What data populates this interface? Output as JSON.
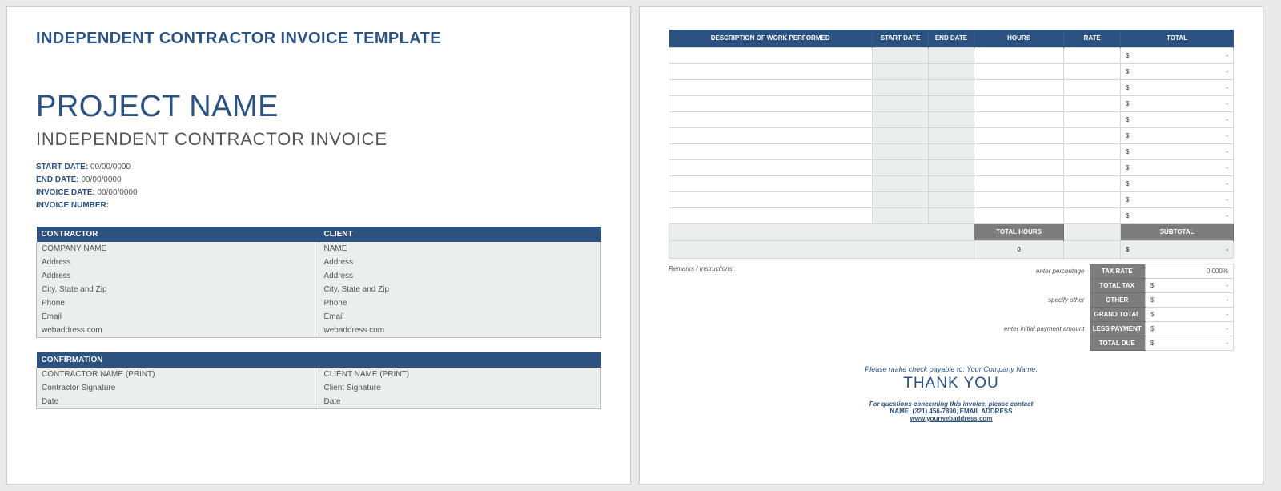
{
  "page1": {
    "title": "INDEPENDENT CONTRACTOR INVOICE TEMPLATE",
    "project": "PROJECT NAME",
    "subtitle": "INDEPENDENT CONTRACTOR INVOICE",
    "meta": {
      "start_label": "START DATE:",
      "start_val": "00/00/0000",
      "end_label": "END DATE:",
      "end_val": "00/00/0000",
      "inv_date_label": "INVOICE DATE:",
      "inv_date_val": "00/00/0000",
      "inv_num_label": "INVOICE NUMBER:",
      "inv_num_val": ""
    },
    "parties": {
      "hdr_contractor": "CONTRACTOR",
      "hdr_client": "CLIENT",
      "rows": [
        [
          "COMPANY NAME",
          "NAME"
        ],
        [
          "Address",
          "Address"
        ],
        [
          "Address",
          "Address"
        ],
        [
          "City, State and Zip",
          "City, State and Zip"
        ],
        [
          "Phone",
          "Phone"
        ],
        [
          "Email",
          "Email"
        ],
        [
          "webaddress.com",
          "webaddress.com"
        ]
      ]
    },
    "confirm": {
      "hdr": "CONFIRMATION",
      "rows": [
        [
          "CONTRACTOR NAME (PRINT)",
          "CLIENT NAME (PRINT)"
        ],
        [
          "Contractor Signature",
          "Client Signature"
        ],
        [
          "Date",
          "Date"
        ]
      ]
    }
  },
  "page2": {
    "headers": {
      "desc": "DESCRIPTION OF WORK PERFORMED",
      "start": "START DATE",
      "end": "END DATE",
      "hours": "HOURS",
      "rate": "RATE",
      "total": "TOTAL"
    },
    "row_total": {
      "cur": "$",
      "dash": "-"
    },
    "row_count": 11,
    "sumrow": {
      "total_hours_label": "TOTAL HOURS",
      "subtotal_label": "SUBTOTAL",
      "total_hours_val": "0",
      "subtotal_cur": "$",
      "subtotal_dash": "-"
    },
    "remarks_label": "Remarks / Instructions:",
    "totals": {
      "tax_hint": "enter percentage",
      "tax_label": "TAX RATE",
      "tax_val": "0.000%",
      "totaltax_label": "TOTAL TAX",
      "other_hint": "specify other",
      "other_label": "OTHER",
      "grand_label": "GRAND TOTAL",
      "less_hint": "enter initial payment amount",
      "less_label": "LESS PAYMENT",
      "due_label": "TOTAL DUE",
      "cur": "$",
      "dash": "-"
    },
    "footer": {
      "payable": "Please make check payable to: Your Company Name.",
      "thanks": "THANK YOU",
      "q": "For questions concerning this invoice, please contact",
      "c": "NAME, (321) 456-7890, EMAIL ADDRESS",
      "w": "www.yourwebaddress.com"
    }
  }
}
